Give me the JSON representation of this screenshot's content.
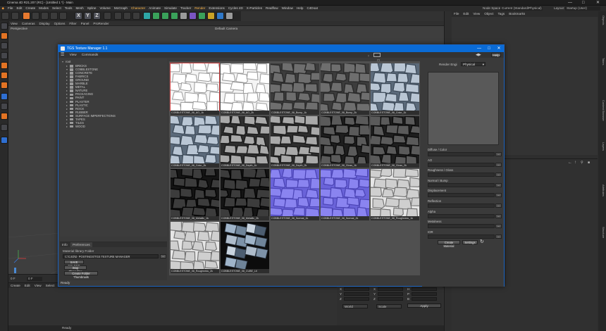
{
  "window": {
    "title": "Cinema 4D R21.207 (RC) - [Untitled 1 *] - Main",
    "controls": [
      "—",
      "□",
      "✕"
    ]
  },
  "main_menu": [
    "File",
    "Edit",
    "Create",
    "Modes",
    "Select",
    "Tools",
    "Mesh",
    "Spline",
    "Volume",
    "MoGraph",
    "Character",
    "Animate",
    "Simulate",
    "Tracker",
    "Render",
    "Extensions",
    "Cycles 4D",
    "X-Particles",
    "Realflow",
    "Window",
    "Help",
    "C4Doat"
  ],
  "layout": {
    "node_space_label": "Node Space:",
    "node_space_value": "Current (Standard/Physical)",
    "layout_label": "Layout:",
    "layout_value": "Startup (User)"
  },
  "viewport": {
    "menu": [
      "View",
      "Cameras",
      "Display",
      "Options",
      "Filter",
      "Panel",
      "ProRender"
    ],
    "name": "Perspective",
    "camera": "Default Camera"
  },
  "object_manager": {
    "menu": [
      "File",
      "Edit",
      "View",
      "Object",
      "Tags",
      "Bookmarks"
    ]
  },
  "side_tabs": [
    "Objects",
    "Takes",
    "Content Browser",
    "Layers",
    "Attributes",
    "Structure"
  ],
  "timeline": {
    "frame_start": "0 F",
    "frame_field": "0 F"
  },
  "material_manager": {
    "menu": [
      "Create",
      "Edit",
      "View",
      "Select",
      "Mat",
      "Te"
    ]
  },
  "coordinates": {
    "apply_label": "Apply",
    "world_value": "World",
    "scale_value": "Scale",
    "rows": [
      {
        "a": "X",
        "b": "X",
        "c": "H"
      },
      {
        "a": "Y",
        "b": "Y",
        "c": "P"
      },
      {
        "a": "Z",
        "b": "Z",
        "c": "B"
      }
    ]
  },
  "status_bar": "Ready",
  "texture_manager": {
    "title": "TGS Texture Manager 1.1",
    "menu": [
      "View",
      "Commands"
    ],
    "help_label": "Help",
    "tree_root": "root",
    "folders": [
      "BRICKS",
      "COBBLESTONE",
      "CONCRETE",
      "FABRICS",
      "GROUND",
      "MARBLE",
      "METAL",
      "NATURE",
      "PACKAGING",
      "PAINT",
      "PLASTER",
      "PLASTIC",
      "ROCK",
      "RUBBER",
      "SURFACE IMPERFECTIONS",
      "TAPES",
      "TILES",
      "WOOD"
    ],
    "expanded_folder": "COBBLESTONE",
    "prefs": {
      "tabs": [
        "Info",
        "Preferences"
      ],
      "selected_tab": "Preferences",
      "library_label": "Material library Folder",
      "library_path": "C:\\C4D\\D_POSTINGS\\TGS TEXTURE MANAGER",
      "path_button": "...",
      "save_button": "SAVE FOLDER",
      "stop_button": "Stop Threading",
      "thumbs_button": "Create Folder Thumbnails"
    },
    "textures": [
      {
        "name": "COBBLESTONE_08_AO_1k",
        "style": "ao"
      },
      {
        "name": "COBBLESTONE_08_AO_2k",
        "style": "ao"
      },
      {
        "name": "COBBLESTONE_08_Bump_1k",
        "style": "bump"
      },
      {
        "name": "COBBLESTONE_08_Bump_2k",
        "style": "bump"
      },
      {
        "name": "COBBLESTONE_08_Color_1k",
        "style": "color"
      },
      {
        "name": "COBBLESTONE_08_Color_2k",
        "style": "color"
      },
      {
        "name": "COBBLESTONE_08_Depth_1k",
        "style": "depth"
      },
      {
        "name": "COBBLESTONE_08_Depth_2k",
        "style": "depth"
      },
      {
        "name": "COBBLESTONE_08_Gloss_1k",
        "style": "gloss"
      },
      {
        "name": "COBBLESTONE_08_Gloss_2k",
        "style": "gloss"
      },
      {
        "name": "COBBLESTONE_08_Metallic_1k",
        "style": "metal"
      },
      {
        "name": "COBBLESTONE_08_Metallic_2k",
        "style": "metal"
      },
      {
        "name": "COBBLESTONE_08_Normal_1k",
        "style": "normal"
      },
      {
        "name": "COBBLESTONE_08_Normal_2k",
        "style": "normal"
      },
      {
        "name": "COBBLESTONE_08_Roughness_1k",
        "style": "rough"
      },
      {
        "name": "COBBLESTONE_08_Roughness_2k",
        "style": "rough"
      },
      {
        "name": "COBBLESTONE_08_CUBE_Lit",
        "style": "photo"
      }
    ],
    "selected_index": 0,
    "side": {
      "render_engine_label": "Render Engi",
      "render_engine_value": "Physical",
      "channels": [
        "Diffuse / Color",
        "AO",
        "Roughness / Gloss",
        "Normal / Bump",
        "Displacement",
        "Reflection",
        "Alpha",
        "Metalness",
        "IOR"
      ],
      "create_button": "Create Material",
      "settings_button": "Settings",
      "refresh_icon": "refresh-icon"
    }
  },
  "colors": {
    "accent_blue": "#0a6bd6",
    "c4d_orange": "#e6792f",
    "selection_red": "#d24040"
  }
}
